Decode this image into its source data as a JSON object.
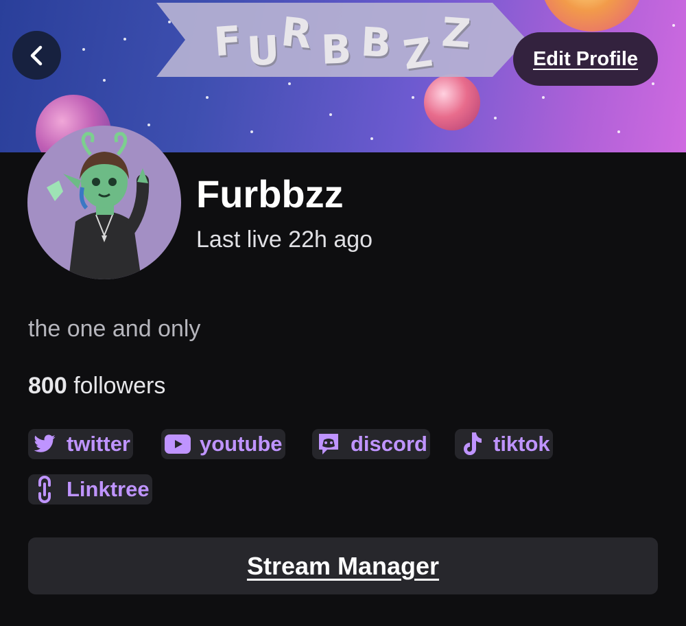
{
  "banner": {
    "title_letters": [
      "F",
      "U",
      "R",
      "B",
      "B",
      "Z",
      "Z"
    ],
    "background_colors": [
      "#2a3f9a",
      "#6d5ad0",
      "#cf6ae0"
    ]
  },
  "header": {
    "back_icon": "chevron-left-icon",
    "edit_profile_label": "Edit Profile"
  },
  "profile": {
    "display_name": "Furbbzz",
    "last_live": "Last live 22h ago",
    "bio": "the one and only",
    "followers_count": "800",
    "followers_label": "followers"
  },
  "social_links": [
    {
      "label": "twitter",
      "icon": "twitter-bird-icon"
    },
    {
      "label": "youtube",
      "icon": "youtube-play-icon"
    },
    {
      "label": "discord",
      "icon": "discord-icon"
    },
    {
      "label": "tiktok",
      "icon": "tiktok-note-icon"
    },
    {
      "label": "Linktree",
      "icon": "linktree-icon"
    }
  ],
  "actions": {
    "stream_manager_label": "Stream Manager"
  },
  "colors": {
    "accent": "#bf94ff",
    "background": "#0e0e10",
    "button_bg": "#27272c",
    "edit_button_bg": "#33223e"
  }
}
